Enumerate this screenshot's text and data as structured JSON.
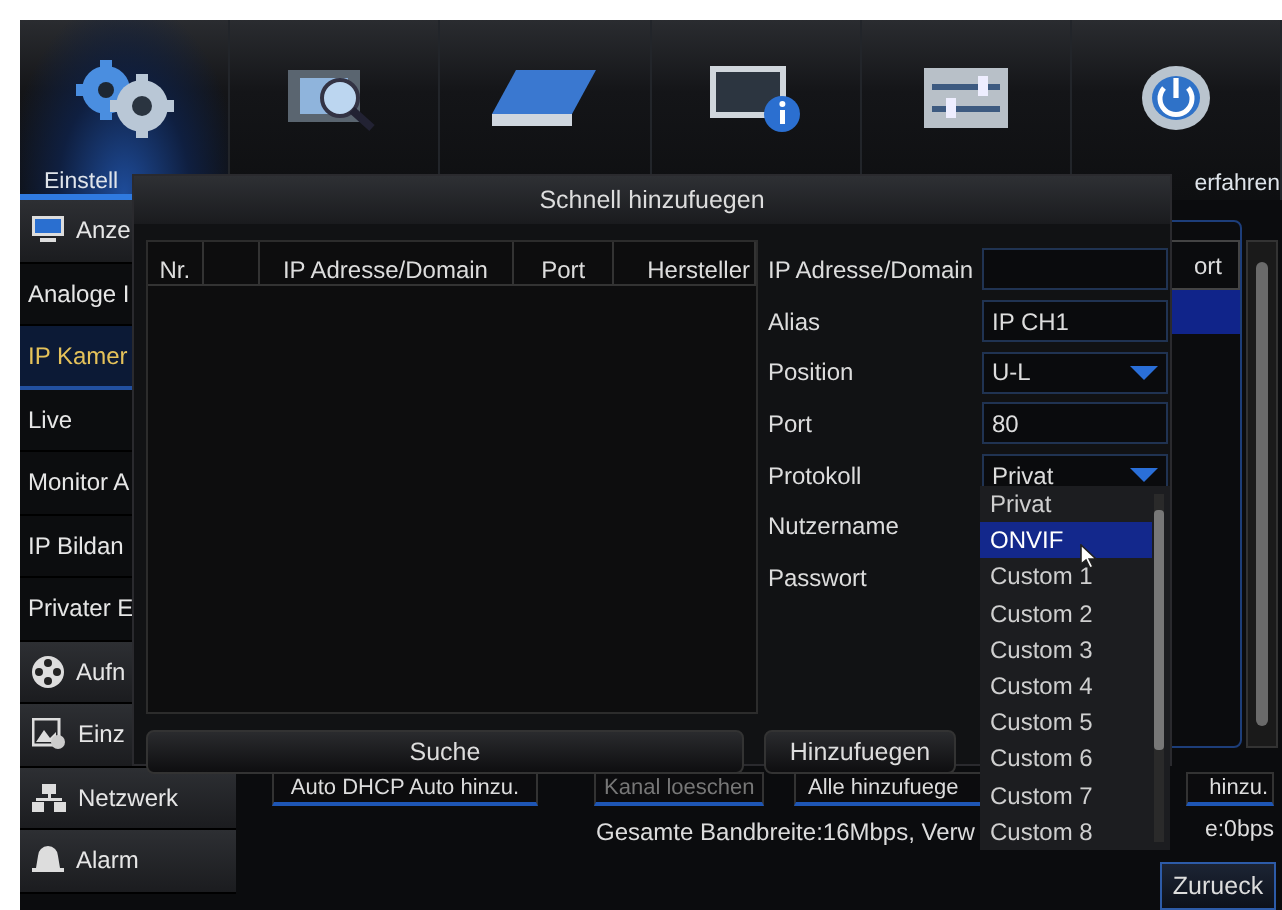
{
  "top_menu": [
    {
      "label": "Einstell",
      "selected": true
    },
    {
      "selected": false
    },
    {
      "selected": false
    },
    {
      "selected": false
    },
    {
      "selected": false
    },
    {
      "label": "erfahren",
      "selected": false
    }
  ],
  "sidebar": {
    "items": [
      {
        "label": "Anze",
        "kind": "header",
        "selected": false
      },
      {
        "label": "Analoge I",
        "kind": "item",
        "selected": false
      },
      {
        "label": "IP Kamer",
        "kind": "item",
        "selected": true
      },
      {
        "label": "Live",
        "kind": "item",
        "selected": false
      },
      {
        "label": "Monitor A",
        "kind": "item",
        "selected": false
      },
      {
        "label": "IP Bildan",
        "kind": "item",
        "selected": false
      },
      {
        "label": "Privater E",
        "kind": "item",
        "selected": false
      },
      {
        "label": "Aufn",
        "kind": "header",
        "selected": false
      },
      {
        "label": "Einz",
        "kind": "header",
        "selected": false
      },
      {
        "label": "Netzwerk",
        "kind": "header",
        "selected": false
      },
      {
        "label": "Alarm",
        "kind": "header",
        "selected": false
      }
    ]
  },
  "channel_table": {
    "columns": [
      "ort"
    ]
  },
  "buttons": [
    {
      "label": "Auto DHCP Auto hinzu.",
      "disabled": false
    },
    {
      "label": "Kanal loeschen",
      "disabled": true
    },
    {
      "label": "Alle hinzufuege",
      "disabled": false
    },
    {
      "label": "hinzu.",
      "disabled": false
    }
  ],
  "status_texts": [
    "Gesamte Bandbreite:16Mbps, Verw",
    "e:0bps"
  ],
  "back_button": "Zurueck",
  "dialog": {
    "title": "Schnell hinzufuegen",
    "table": {
      "columns": [
        "Nr.",
        "",
        "IP Adresse/Domain",
        "Port",
        "Hersteller"
      ]
    },
    "fields": [
      {
        "label": "IP Adresse/Domain",
        "kind": "text"
      },
      {
        "label": "Alias",
        "kind": "text",
        "value": "IP CH1"
      },
      {
        "label": "Position",
        "kind": "select",
        "value": "U-L"
      },
      {
        "label": "Port",
        "kind": "text",
        "value": "80"
      },
      {
        "label": "Protokoll",
        "kind": "select",
        "value": "Privat"
      },
      {
        "label": "Nutzername",
        "kind": "label"
      },
      {
        "label": "Passwort",
        "kind": "label"
      }
    ],
    "buttons": [
      "Suche",
      "Hinzufuegen"
    ],
    "dropdown": {
      "options": [
        {
          "label": "Privat",
          "selected": false
        },
        {
          "label": "ONVIF",
          "selected": true
        },
        {
          "label": "Custom 1",
          "selected": false
        },
        {
          "label": "Custom 2",
          "selected": false
        },
        {
          "label": "Custom 3",
          "selected": false
        },
        {
          "label": "Custom 4",
          "selected": false
        },
        {
          "label": "Custom 5",
          "selected": false
        },
        {
          "label": "Custom 6",
          "selected": false
        },
        {
          "label": "Custom 7",
          "selected": false
        },
        {
          "label": "Custom 8",
          "selected": false
        }
      ]
    }
  }
}
